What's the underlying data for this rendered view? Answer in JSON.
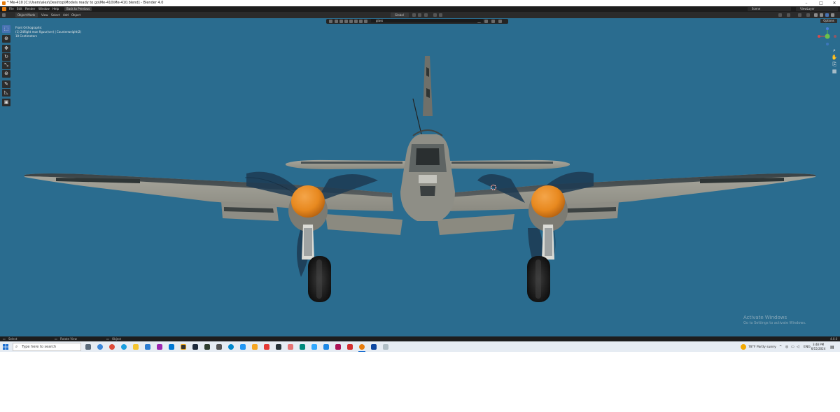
{
  "window": {
    "title": "* Me-410 [C:\\Users\\alex\\Desktop\\Models ready to go\\Me-410\\Me-410.blend] - Blender 4.0",
    "controls": {
      "minimize": "–",
      "maximize": "□",
      "close": "✕"
    }
  },
  "menubar": {
    "items": [
      "File",
      "Edit",
      "Render",
      "Window",
      "Help"
    ],
    "workspace_tab": "Back to Previous",
    "scene": "Scene",
    "view_layer": "ViewLayer"
  },
  "viewport_header": {
    "mode": "Object Mode",
    "menus": [
      "View",
      "Select",
      "Add",
      "Object"
    ],
    "orientation": "Global"
  },
  "viewport": {
    "search": {
      "value": "glass",
      "placeholder": ""
    },
    "overlay_lines": [
      "Front Orthographic",
      "(1) 24flight mon figuur(ver) | Counterweight(2)",
      "10 Centimeters"
    ],
    "options_label": "Options",
    "tools": [
      {
        "name": "select-box-tool",
        "glyph": "⬚"
      },
      {
        "name": "cursor-tool",
        "glyph": "⊕"
      },
      {
        "name": "move-tool",
        "glyph": "✥"
      },
      {
        "name": "rotate-tool",
        "glyph": "↻"
      },
      {
        "name": "scale-tool",
        "glyph": "⤡"
      },
      {
        "name": "transform-tool",
        "glyph": "⊛"
      },
      {
        "name": "annotate-tool",
        "glyph": "✎"
      },
      {
        "name": "measure-tool",
        "glyph": "◺"
      },
      {
        "name": "add-cube-tool",
        "glyph": "▣"
      }
    ],
    "nav_buttons": [
      {
        "name": "zoom-icon",
        "glyph": "⌕"
      },
      {
        "name": "pan-hand-icon",
        "glyph": "✋"
      },
      {
        "name": "camera-view-icon",
        "glyph": "⎘"
      },
      {
        "name": "grid-view-icon",
        "glyph": "▦"
      }
    ],
    "activate_line1": "Activate Windows",
    "activate_line2": "Go to Settings to activate Windows."
  },
  "statusbar": {
    "left": "Select",
    "middle": "Rotate View",
    "right": "Object",
    "version": "4.0.0"
  },
  "taskbar": {
    "search_placeholder": "Type here to search",
    "weather": "78°F  Partly sunny",
    "language": "ENG",
    "time": "3:48 PM",
    "date": "6/15/2024"
  },
  "colors": {
    "viewport_bg": "#2a6c8f",
    "blender_dark": "#1d1d1d",
    "accent": "#4772b3",
    "spinner_orange": "#e8891f"
  }
}
